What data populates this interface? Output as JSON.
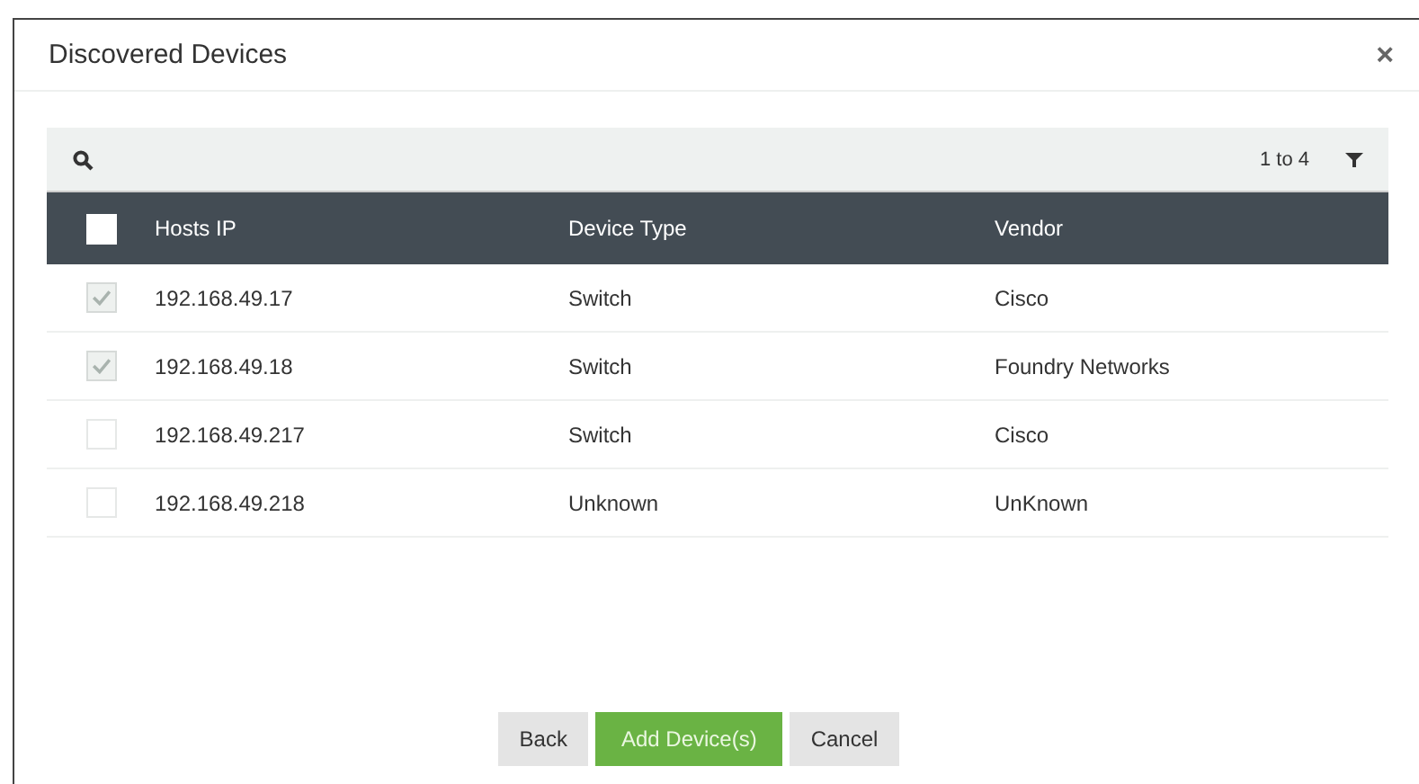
{
  "dialog": {
    "title": "Discovered Devices",
    "close": "×"
  },
  "table": {
    "range": "1 to 4",
    "header_checked": false,
    "columns": [
      "Hosts IP",
      "Device Type",
      "Vendor"
    ],
    "rows": [
      {
        "checked": true,
        "cells": [
          "192.168.49.17",
          "Switch",
          "Cisco"
        ]
      },
      {
        "checked": true,
        "cells": [
          "192.168.49.18",
          "Switch",
          "Foundry Networks"
        ]
      },
      {
        "checked": false,
        "cells": [
          "192.168.49.217",
          "Switch",
          "Cisco"
        ]
      },
      {
        "checked": false,
        "cells": [
          "192.168.49.218",
          "Unknown",
          "UnKnown"
        ]
      }
    ]
  },
  "buttons": [
    {
      "label": "Back",
      "kind": "secondary"
    },
    {
      "label": "Add Device(s)",
      "kind": "primary"
    },
    {
      "label": "Cancel",
      "kind": "secondary"
    }
  ]
}
